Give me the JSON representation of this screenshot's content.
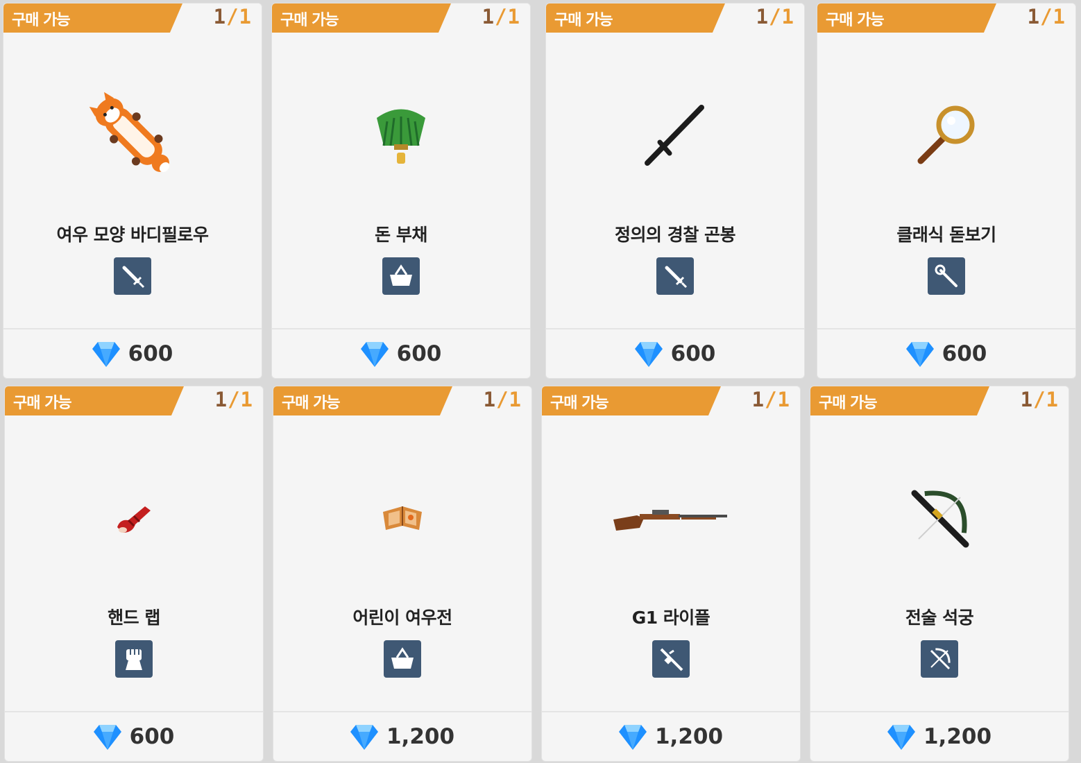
{
  "status_label": "구매 가능",
  "items": [
    {
      "name": "여우 모양 바디필로우",
      "have": "1",
      "sep": "/",
      "max": "1",
      "price": "600",
      "type_icon": "sword-icon",
      "art_icon": "fox-pillow-icon"
    },
    {
      "name": "돈 부채",
      "have": "1",
      "sep": "/",
      "max": "1",
      "price": "600",
      "type_icon": "basket-icon",
      "art_icon": "money-fan-icon"
    },
    {
      "name": "정의의 경찰 곤봉",
      "have": "1",
      "sep": "/",
      "max": "1",
      "price": "600",
      "type_icon": "sword-icon",
      "art_icon": "police-baton-icon"
    },
    {
      "name": "클래식 돋보기",
      "have": "1",
      "sep": "/",
      "max": "1",
      "price": "600",
      "type_icon": "staff-icon",
      "art_icon": "magnifier-icon"
    },
    {
      "name": "핸드 랩",
      "have": "1",
      "sep": "/",
      "max": "1",
      "price": "600",
      "type_icon": "fist-icon",
      "art_icon": "hand-wrap-icon"
    },
    {
      "name": "어린이 여우전",
      "have": "1",
      "sep": "/",
      "max": "1",
      "price": "1,200",
      "type_icon": "basket-icon",
      "art_icon": "fox-book-icon"
    },
    {
      "name": "G1 라이플",
      "have": "1",
      "sep": "/",
      "max": "1",
      "price": "1,200",
      "type_icon": "rifle-icon",
      "art_icon": "g1-rifle-icon"
    },
    {
      "name": "전술 석궁",
      "have": "1",
      "sep": "/",
      "max": "1",
      "price": "1,200",
      "type_icon": "crossbow-icon",
      "art_icon": "crossbow-art-icon"
    }
  ],
  "colors": {
    "banner": "#e99a33",
    "count_have": "#8a5a35",
    "type_icon_bg": "#3f5874",
    "gem": "#1e90ff"
  }
}
